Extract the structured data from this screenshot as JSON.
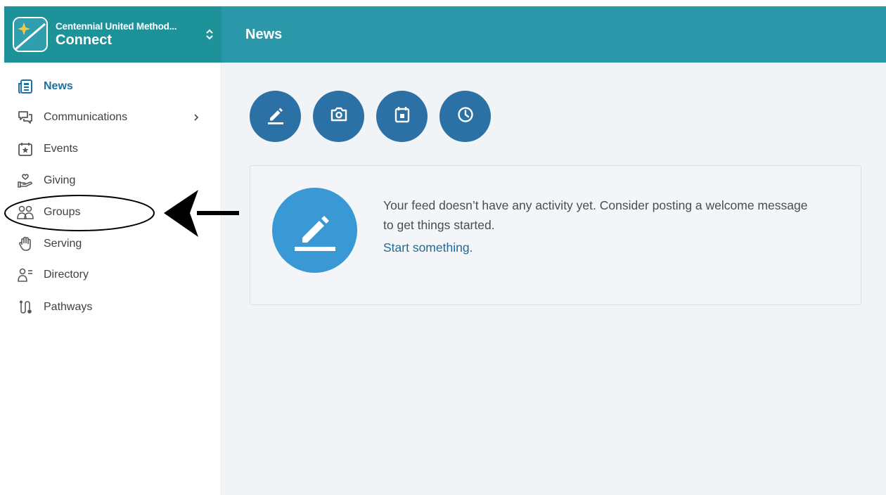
{
  "header": {
    "org_name": "Centennial United Method...",
    "app_name": "Connect",
    "page_title": "News"
  },
  "sidebar": {
    "items": [
      {
        "label": "News",
        "icon": "newspaper-icon",
        "active": true
      },
      {
        "label": "Communications",
        "icon": "chat-bubbles-icon",
        "has_submenu": true
      },
      {
        "label": "Events",
        "icon": "calendar-star-icon"
      },
      {
        "label": "Giving",
        "icon": "hand-heart-icon"
      },
      {
        "label": "Groups",
        "icon": "people-icon"
      },
      {
        "label": "Serving",
        "icon": "raised-hand-icon"
      },
      {
        "label": "Directory",
        "icon": "person-list-icon"
      },
      {
        "label": "Pathways",
        "icon": "pathway-icon"
      }
    ]
  },
  "main": {
    "actions": [
      {
        "icon": "pencil-icon"
      },
      {
        "icon": "camera-icon"
      },
      {
        "icon": "calendar-icon"
      },
      {
        "icon": "clock-icon"
      }
    ],
    "feed": {
      "empty_message": "Your feed doesn’t have any activity yet. Consider posting a welcome message to get things started.",
      "start_link": "Start something."
    }
  },
  "colors": {
    "header_left": "#1e9299",
    "header_main": "#2a98a8",
    "action_button": "#2c71a5",
    "feed_icon": "#3a99d5",
    "link": "#1f6a9c",
    "active_nav": "#1f6f9f"
  },
  "annotation": {
    "highlight_target": "Groups",
    "shapes": [
      "ellipse",
      "arrow"
    ]
  }
}
